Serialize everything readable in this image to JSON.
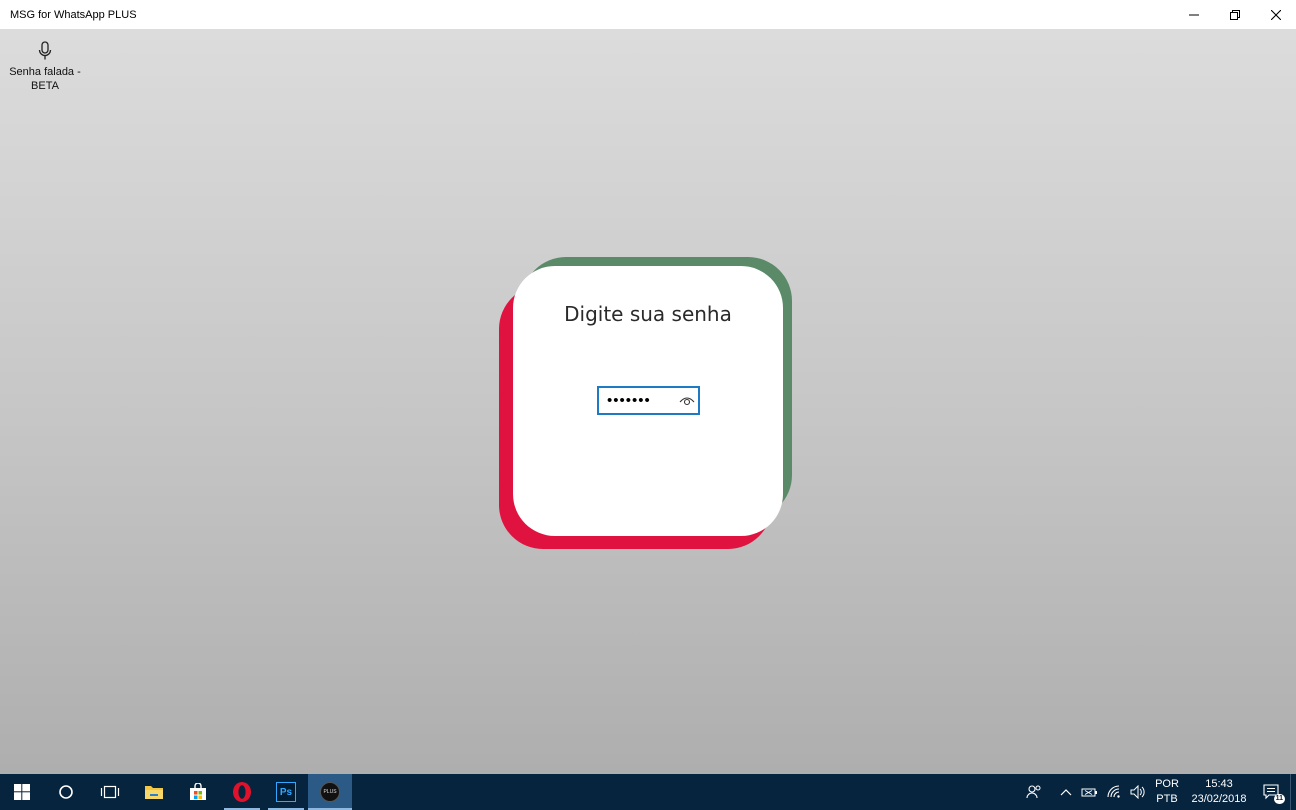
{
  "window": {
    "title": "MSG for WhatsApp PLUS"
  },
  "toolbar": {
    "voice_password_label": "Senha falada - BETA",
    "voice_icon": "microphone-icon"
  },
  "login": {
    "prompt": "Digite sua senha",
    "password_masked": "•••••••",
    "reveal_icon": "eye-icon",
    "colors": {
      "green": "#5a8a68",
      "red": "#e0123f",
      "focus": "#1f7ac4"
    }
  },
  "taskbar": {
    "apps": [
      "start",
      "cortana",
      "task-view",
      "file-explorer",
      "store",
      "opera",
      "photoshop",
      "msg-plus"
    ],
    "photoshop_label": "Ps",
    "plus_label": "PLUS",
    "language": {
      "line1": "POR",
      "line2": "PTB"
    },
    "clock": {
      "time": "15:43",
      "date": "23/02/2018"
    },
    "notification_count": "11"
  }
}
